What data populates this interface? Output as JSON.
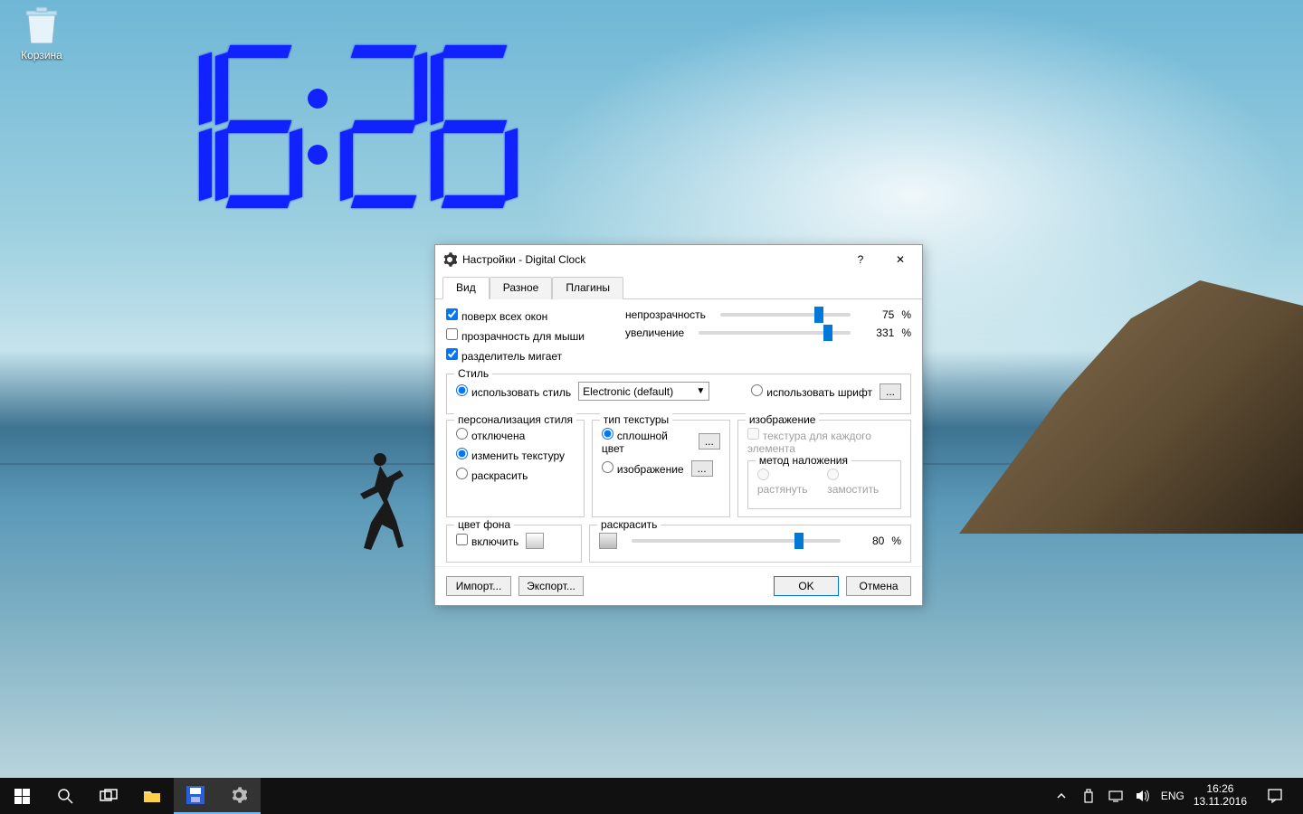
{
  "desktop": {
    "recycle_bin_label": "Корзина",
    "clock_digits": "16:26"
  },
  "dialog": {
    "title": "Настройки - Digital Clock",
    "help_char": "?",
    "tabs": [
      "Вид",
      "Разное",
      "Плагины"
    ],
    "active_tab": 0,
    "checkboxes": {
      "on_top": "поверх всех окон",
      "mouse_transparency": "прозрачность для мыши",
      "separator_blinks": "разделитель мигает"
    },
    "checkbox_state": {
      "on_top": true,
      "mouse_transparency": false,
      "separator_blinks": true
    },
    "opacity_label": "непрозрачность",
    "opacity_value": "75",
    "zoom_label": "увеличение",
    "zoom_value": "331",
    "percent": "%",
    "style_group": "Стиль",
    "use_style": "использовать стиль",
    "style_selected": "Electronic (default)",
    "use_font": "использовать шрифт",
    "browse": "...",
    "personalization_group": "персонализация стиля",
    "personalization": {
      "off": "отключена",
      "texture": "изменить текстуру",
      "colorize": "раскрасить"
    },
    "personalization_selected": "texture",
    "texture_type_group": "тип текстуры",
    "texture_type": {
      "solid": "сплошной цвет",
      "image": "изображение"
    },
    "texture_type_selected": "solid",
    "image_group": "изображение",
    "texture_per_element": "текстура для каждого элемента",
    "blend_group": "метод наложения",
    "blend": {
      "stretch": "растянуть",
      "tile": "замостить"
    },
    "bg_group": "цвет фона",
    "bg_enable": "включить",
    "colorize_group": "раскрасить",
    "colorize_value": "80",
    "buttons": {
      "import": "Импорт...",
      "export": "Экспорт...",
      "ok": "OK",
      "cancel": "Отмена"
    }
  },
  "taskbar": {
    "lang": "ENG",
    "time": "16:26",
    "date": "13.11.2016"
  }
}
